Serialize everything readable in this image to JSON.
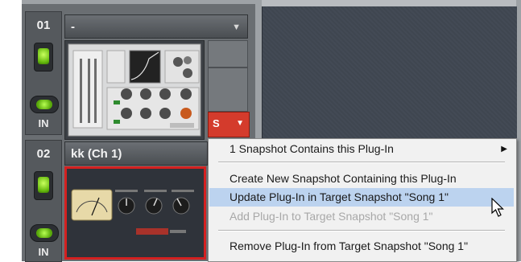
{
  "channels": [
    {
      "number": "01",
      "name": "-",
      "in_label": "IN"
    },
    {
      "number": "02",
      "name": "kk (Ch 1)",
      "in_label": "IN"
    }
  ],
  "snapshot_button": {
    "label": "S"
  },
  "context_menu": {
    "items": [
      {
        "label": "1 Snapshot Contains this Plug-In",
        "state": "submenu"
      },
      {
        "label": "Create New Snapshot Containing this Plug-In",
        "state": "normal"
      },
      {
        "label": "Update Plug-In in Target Snapshot \"Song 1\"",
        "state": "highlighted"
      },
      {
        "label": "Add Plug-In to Target Snapshot \"Song 1\"",
        "state": "disabled"
      },
      {
        "label": "Remove Plug-In from Target Snapshot \"Song 1\"",
        "state": "normal"
      }
    ]
  },
  "colors": {
    "menu_highlight": "#bcd3ef",
    "snapshot_button": "#d43b2c",
    "selected_plugin_border": "#d42020",
    "led_green": "#7fd41a"
  }
}
